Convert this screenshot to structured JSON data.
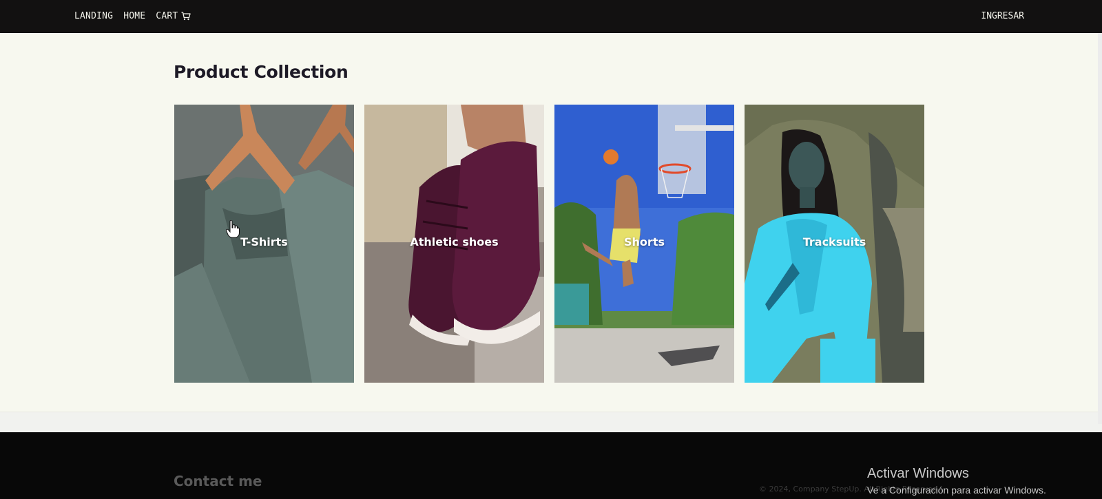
{
  "nav": {
    "links": [
      "LANDING",
      "HOME",
      "CART"
    ],
    "cart_icon": "shopping-cart-icon",
    "login_label": "INGRESAR"
  },
  "main": {
    "title": "Product Collection",
    "cards": [
      {
        "label": "T-Shirts",
        "image": "green t-shirts on wooden hangers"
      },
      {
        "label": "Athletic shoes",
        "image": "purple suede sneakers"
      },
      {
        "label": "Shorts",
        "image": "basketball player dunking"
      },
      {
        "label": "Tracksuits",
        "image": "woman in cyan track jacket"
      }
    ]
  },
  "footer": {
    "contact_title": "Contact me",
    "copyright": "© 2024, Company StepUp. All Rights Reserved."
  },
  "watermark": {
    "title": "Activar Windows",
    "subtitle": "Ve a Configuración para activar Windows."
  },
  "colors": {
    "nav_bg": "#121111",
    "page_bg": "#f7f8ef",
    "footer_bg": "#080808",
    "title": "#1d1a26"
  }
}
